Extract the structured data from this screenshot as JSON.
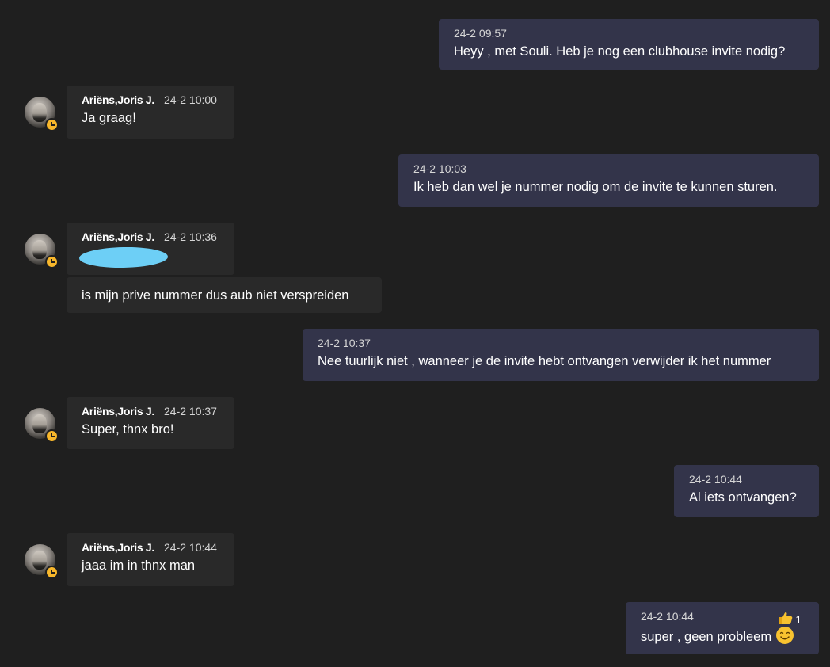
{
  "messages": [
    {
      "side": "me",
      "time": "24-2 09:57",
      "text": "Heyy , met Souli. Heb je nog een clubhouse invite nodig?"
    },
    {
      "side": "them",
      "sender": "Ariëns,Joris J.",
      "time": "24-2 10:00",
      "text": "Ja graag!"
    },
    {
      "side": "me",
      "time": "24-2 10:03",
      "text": "Ik heb dan wel je nummer nodig om de invite te kunnen sturen."
    },
    {
      "side": "them",
      "sender": "Ariëns,Joris J.",
      "time": "24-2 10:36",
      "text": "[redacted phone number]"
    },
    {
      "side": "them",
      "text": "is mijn prive nummer dus aub niet verspreiden"
    },
    {
      "side": "me",
      "time": "24-2 10:37",
      "text": "Nee tuurlijk niet , wanneer je de invite hebt ontvangen verwijder ik het nummer"
    },
    {
      "side": "them",
      "sender": "Ariëns,Joris J.",
      "time": "24-2 10:37",
      "text": "Super, thnx bro!"
    },
    {
      "side": "me",
      "time": "24-2 10:44",
      "text": "Al iets ontvangen?"
    },
    {
      "side": "them",
      "sender": "Ariëns,Joris J.",
      "time": "24-2 10:44",
      "text": "jaaa im in thnx man"
    },
    {
      "side": "me",
      "time": "24-2 10:44",
      "text": "super , geen probleem",
      "reaction": {
        "icon": "thumbs-up-icon",
        "count": "1"
      },
      "emoji": "smiling-face-icon"
    }
  ],
  "colors": {
    "background": "#1f1f1f",
    "my_bubble": "#33344a",
    "their_bubble": "#292929",
    "status_away": "#f8b72b",
    "redaction": "#6dcff6"
  }
}
